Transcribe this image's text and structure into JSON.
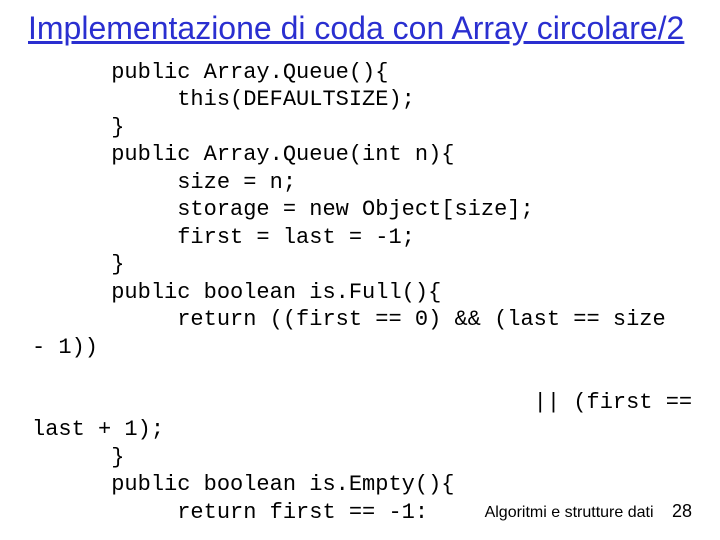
{
  "title": "Implementazione di coda con Array circolare/2",
  "code": "      public Array.Queue(){\n           this(DEFAULTSIZE);\n      }\n      public Array.Queue(int n){\n           size = n;\n           storage = new Object[size];\n           first = last = -1;\n      }\n      public boolean is.Full(){\n           return ((first == 0) && (last == size\n- 1))\n\n                                      || (first ==\nlast + 1);\n      }\n      public boolean is.Empty(){\n           return first == -1:",
  "footer": {
    "label": "Algoritmi e strutture dati",
    "page": "28"
  }
}
